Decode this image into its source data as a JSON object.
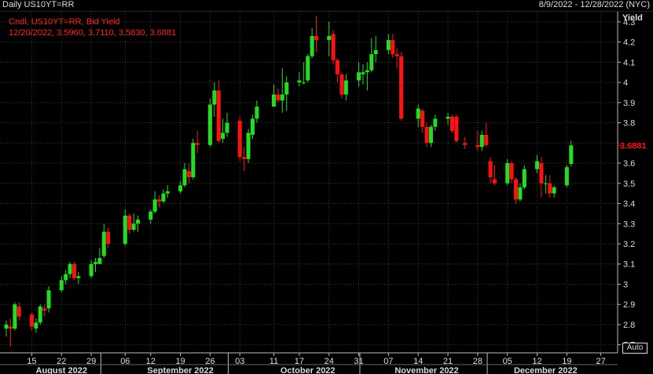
{
  "header": {
    "title": "Daily US10YT=RR",
    "date_range": "8/9/2022 - 12/28/2022 (NYC)"
  },
  "legend": {
    "line1": "Cndl, US10YT=RR, Bid Yield",
    "line2": "12/20/2022, 3.5960, 3.7110, 3.5830, 3.6881"
  },
  "auto_label": "Auto",
  "colors": {
    "up": "#22dd22",
    "down": "#ff1111",
    "grid": "#3a3a3a",
    "last_badge": "#ff1111"
  },
  "chart_data": {
    "type": "candlestick",
    "y_axis_label": "Yield",
    "ylim": [
      2.66,
      4.35
    ],
    "y_ticks": [
      2.7,
      2.8,
      2.9,
      3,
      3.1,
      3.2,
      3.3,
      3.4,
      3.5,
      3.6,
      3.7,
      3.8,
      3.9,
      4,
      4.1,
      4.2,
      4.3
    ],
    "y_tick_labels": [
      "2.7",
      "2.8",
      "2.9",
      "3",
      "3.1",
      "3.2",
      "3.3",
      "3.4",
      "3.5",
      "3.6",
      "3.7",
      "3.8",
      "3.9",
      "4",
      "4.1",
      "4.2",
      "4.3"
    ],
    "last_value": "3.6881",
    "grid": true,
    "x_day_ticks": [
      {
        "date": "2022-08-15",
        "label": "15"
      },
      {
        "date": "2022-08-22",
        "label": "22"
      },
      {
        "date": "2022-08-29",
        "label": "29"
      },
      {
        "date": "2022-09-06",
        "label": "06"
      },
      {
        "date": "2022-09-12",
        "label": "12"
      },
      {
        "date": "2022-09-19",
        "label": "19"
      },
      {
        "date": "2022-09-26",
        "label": "26"
      },
      {
        "date": "2022-10-03",
        "label": "03"
      },
      {
        "date": "2022-10-11",
        "label": "11"
      },
      {
        "date": "2022-10-17",
        "label": "17"
      },
      {
        "date": "2022-10-24",
        "label": "24"
      },
      {
        "date": "2022-10-31",
        "label": "31"
      },
      {
        "date": "2022-11-07",
        "label": "07"
      },
      {
        "date": "2022-11-14",
        "label": "14"
      },
      {
        "date": "2022-11-21",
        "label": "21"
      },
      {
        "date": "2022-11-28",
        "label": "28"
      },
      {
        "date": "2022-12-05",
        "label": "05"
      },
      {
        "date": "2022-12-12",
        "label": "12"
      },
      {
        "date": "2022-12-19",
        "label": "19"
      },
      {
        "date": "2022-12-27",
        "label": "27"
      }
    ],
    "x_months": [
      {
        "label": "August 2022",
        "date": "2022-08-22"
      },
      {
        "label": "September 2022",
        "date": "2022-09-19"
      },
      {
        "label": "October 2022",
        "date": "2022-10-19"
      },
      {
        "label": "November 2022",
        "date": "2022-11-16"
      },
      {
        "label": "December 2022",
        "date": "2022-12-14"
      }
    ],
    "x_month_boundaries": [
      "2022-09-01",
      "2022-10-01",
      "2022-11-01",
      "2022-12-01"
    ],
    "x_range": [
      "2022-08-09",
      "2022-12-28"
    ],
    "candles": [
      {
        "d": "2022-08-09",
        "o": 2.78,
        "h": 2.82,
        "l": 2.74,
        "c": 2.8
      },
      {
        "d": "2022-08-10",
        "o": 2.79,
        "h": 2.83,
        "l": 2.69,
        "c": 2.78
      },
      {
        "d": "2022-08-11",
        "o": 2.78,
        "h": 2.91,
        "l": 2.77,
        "c": 2.9
      },
      {
        "d": "2022-08-12",
        "o": 2.89,
        "h": 2.91,
        "l": 2.82,
        "c": 2.84
      },
      {
        "d": "2022-08-15",
        "o": 2.85,
        "h": 2.86,
        "l": 2.77,
        "c": 2.79
      },
      {
        "d": "2022-08-16",
        "o": 2.78,
        "h": 2.83,
        "l": 2.76,
        "c": 2.81
      },
      {
        "d": "2022-08-17",
        "o": 2.81,
        "h": 2.9,
        "l": 2.8,
        "c": 2.89
      },
      {
        "d": "2022-08-18",
        "o": 2.88,
        "h": 2.9,
        "l": 2.84,
        "c": 2.87
      },
      {
        "d": "2022-08-19",
        "o": 2.88,
        "h": 2.99,
        "l": 2.86,
        "c": 2.97
      },
      {
        "d": "2022-08-22",
        "o": 2.97,
        "h": 3.04,
        "l": 2.96,
        "c": 3.02
      },
      {
        "d": "2022-08-23",
        "o": 3.02,
        "h": 3.07,
        "l": 3.0,
        "c": 3.05
      },
      {
        "d": "2022-08-24",
        "o": 3.05,
        "h": 3.11,
        "l": 3.03,
        "c": 3.1
      },
      {
        "d": "2022-08-25",
        "o": 3.1,
        "h": 3.11,
        "l": 3.02,
        "c": 3.03
      },
      {
        "d": "2022-08-26",
        "o": 3.03,
        "h": 3.06,
        "l": 3.0,
        "c": 3.04
      },
      {
        "d": "2022-08-29",
        "o": 3.04,
        "h": 3.12,
        "l": 3.03,
        "c": 3.1
      },
      {
        "d": "2022-08-30",
        "o": 3.1,
        "h": 3.13,
        "l": 3.06,
        "c": 3.11
      },
      {
        "d": "2022-08-31",
        "o": 3.1,
        "h": 3.18,
        "l": 3.1,
        "c": 3.13
      },
      {
        "d": "2022-09-01",
        "o": 3.14,
        "h": 3.3,
        "l": 3.13,
        "c": 3.26
      },
      {
        "d": "2022-09-02",
        "o": 3.26,
        "h": 3.28,
        "l": 3.18,
        "c": 3.2
      },
      {
        "d": "2022-09-06",
        "o": 3.2,
        "h": 3.37,
        "l": 3.19,
        "c": 3.34
      },
      {
        "d": "2022-09-07",
        "o": 3.34,
        "h": 3.35,
        "l": 3.25,
        "c": 3.27
      },
      {
        "d": "2022-09-08",
        "o": 3.27,
        "h": 3.35,
        "l": 3.26,
        "c": 3.3
      },
      {
        "d": "2022-09-09",
        "o": 3.3,
        "h": 3.34,
        "l": 3.26,
        "c": 3.32
      },
      {
        "d": "2022-09-12",
        "o": 3.32,
        "h": 3.37,
        "l": 3.3,
        "c": 3.36
      },
      {
        "d": "2022-09-13",
        "o": 3.36,
        "h": 3.46,
        "l": 3.35,
        "c": 3.42
      },
      {
        "d": "2022-09-14",
        "o": 3.42,
        "h": 3.44,
        "l": 3.38,
        "c": 3.41
      },
      {
        "d": "2022-09-15",
        "o": 3.41,
        "h": 3.47,
        "l": 3.4,
        "c": 3.45
      },
      {
        "d": "2022-09-16",
        "o": 3.45,
        "h": 3.49,
        "l": 3.43,
        "c": 3.46
      },
      {
        "d": "2022-09-19",
        "o": 3.46,
        "h": 3.51,
        "l": 3.45,
        "c": 3.49
      },
      {
        "d": "2022-09-20",
        "o": 3.49,
        "h": 3.6,
        "l": 3.48,
        "c": 3.57
      },
      {
        "d": "2022-09-21",
        "o": 3.56,
        "h": 3.6,
        "l": 3.5,
        "c": 3.53
      },
      {
        "d": "2022-09-22",
        "o": 3.53,
        "h": 3.72,
        "l": 3.52,
        "c": 3.7
      },
      {
        "d": "2022-09-23",
        "o": 3.7,
        "h": 3.76,
        "l": 3.65,
        "c": 3.69
      },
      {
        "d": "2022-09-26",
        "o": 3.69,
        "h": 3.92,
        "l": 3.68,
        "c": 3.89
      },
      {
        "d": "2022-09-27",
        "o": 3.89,
        "h": 4.0,
        "l": 3.83,
        "c": 3.96
      },
      {
        "d": "2022-09-28",
        "o": 3.96,
        "h": 4.01,
        "l": 3.7,
        "c": 3.71
      },
      {
        "d": "2022-09-29",
        "o": 3.72,
        "h": 3.82,
        "l": 3.7,
        "c": 3.75
      },
      {
        "d": "2022-09-30",
        "o": 3.75,
        "h": 3.85,
        "l": 3.73,
        "c": 3.8
      },
      {
        "d": "2022-10-03",
        "o": 3.81,
        "h": 3.83,
        "l": 3.61,
        "c": 3.63
      },
      {
        "d": "2022-10-04",
        "o": 3.63,
        "h": 3.68,
        "l": 3.56,
        "c": 3.62
      },
      {
        "d": "2022-10-05",
        "o": 3.62,
        "h": 3.77,
        "l": 3.6,
        "c": 3.75
      },
      {
        "d": "2022-10-06",
        "o": 3.74,
        "h": 3.84,
        "l": 3.72,
        "c": 3.82
      },
      {
        "d": "2022-10-07",
        "o": 3.82,
        "h": 3.91,
        "l": 3.8,
        "c": 3.88
      },
      {
        "d": "2022-10-11",
        "o": 3.88,
        "h": 3.99,
        "l": 3.88,
        "c": 3.94
      },
      {
        "d": "2022-10-12",
        "o": 3.94,
        "h": 3.97,
        "l": 3.9,
        "c": 3.91
      },
      {
        "d": "2022-10-13",
        "o": 3.91,
        "h": 4.07,
        "l": 3.85,
        "c": 3.94
      },
      {
        "d": "2022-10-14",
        "o": 3.94,
        "h": 4.03,
        "l": 3.86,
        "c": 4.0
      },
      {
        "d": "2022-10-17",
        "o": 4.0,
        "h": 4.05,
        "l": 3.98,
        "c": 4.01
      },
      {
        "d": "2022-10-18",
        "o": 4.0,
        "h": 4.1,
        "l": 3.99,
        "c": 4.0
      },
      {
        "d": "2022-10-19",
        "o": 4.01,
        "h": 4.14,
        "l": 4.0,
        "c": 4.13
      },
      {
        "d": "2022-10-20",
        "o": 4.13,
        "h": 4.27,
        "l": 4.12,
        "c": 4.23
      },
      {
        "d": "2022-10-21",
        "o": 4.23,
        "h": 4.33,
        "l": 4.15,
        "c": 4.21
      },
      {
        "d": "2022-10-24",
        "o": 4.21,
        "h": 4.3,
        "l": 4.13,
        "c": 4.23
      },
      {
        "d": "2022-10-25",
        "o": 4.24,
        "h": 4.26,
        "l": 4.09,
        "c": 4.11
      },
      {
        "d": "2022-10-26",
        "o": 4.11,
        "h": 4.12,
        "l": 4.0,
        "c": 4.04
      },
      {
        "d": "2022-10-27",
        "o": 4.04,
        "h": 4.05,
        "l": 3.92,
        "c": 3.94
      },
      {
        "d": "2022-10-28",
        "o": 3.94,
        "h": 4.04,
        "l": 3.91,
        "c": 4.01
      },
      {
        "d": "2022-10-31",
        "o": 4.01,
        "h": 4.1,
        "l": 3.98,
        "c": 4.05
      },
      {
        "d": "2022-11-01",
        "o": 4.04,
        "h": 4.09,
        "l": 3.99,
        "c": 4.05
      },
      {
        "d": "2022-11-02",
        "o": 4.05,
        "h": 4.1,
        "l": 3.96,
        "c": 4.06
      },
      {
        "d": "2022-11-03",
        "o": 4.06,
        "h": 4.22,
        "l": 4.05,
        "c": 4.14
      },
      {
        "d": "2022-11-04",
        "o": 4.14,
        "h": 4.23,
        "l": 4.1,
        "c": 4.16
      },
      {
        "d": "2022-11-07",
        "o": 4.16,
        "h": 4.24,
        "l": 4.14,
        "c": 4.21
      },
      {
        "d": "2022-11-08",
        "o": 4.21,
        "h": 4.24,
        "l": 4.12,
        "c": 4.14
      },
      {
        "d": "2022-11-09",
        "o": 4.14,
        "h": 4.17,
        "l": 4.07,
        "c": 4.13
      },
      {
        "d": "2022-11-10",
        "o": 4.13,
        "h": 4.15,
        "l": 3.81,
        "c": 3.82
      },
      {
        "d": "2022-11-14",
        "o": 3.82,
        "h": 3.89,
        "l": 3.78,
        "c": 3.87
      },
      {
        "d": "2022-11-15",
        "o": 3.86,
        "h": 3.87,
        "l": 3.75,
        "c": 3.78
      },
      {
        "d": "2022-11-16",
        "o": 3.78,
        "h": 3.8,
        "l": 3.68,
        "c": 3.7
      },
      {
        "d": "2022-11-17",
        "o": 3.7,
        "h": 3.79,
        "l": 3.68,
        "c": 3.78
      },
      {
        "d": "2022-11-18",
        "o": 3.78,
        "h": 3.84,
        "l": 3.76,
        "c": 3.82
      },
      {
        "d": "2022-11-21",
        "o": 3.82,
        "h": 3.85,
        "l": 3.79,
        "c": 3.83
      },
      {
        "d": "2022-11-22",
        "o": 3.83,
        "h": 3.84,
        "l": 3.75,
        "c": 3.76
      },
      {
        "d": "2022-11-23",
        "o": 3.83,
        "h": 3.84,
        "l": 3.7,
        "c": 3.71
      },
      {
        "d": "2022-11-25",
        "o": 3.7,
        "h": 3.73,
        "l": 3.67,
        "c": 3.69
      },
      {
        "d": "2022-11-28",
        "o": 3.69,
        "h": 3.76,
        "l": 3.66,
        "c": 3.68
      },
      {
        "d": "2022-11-29",
        "o": 3.68,
        "h": 3.76,
        "l": 3.66,
        "c": 3.74
      },
      {
        "d": "2022-11-30",
        "o": 3.74,
        "h": 3.8,
        "l": 3.68,
        "c": 3.69
      },
      {
        "d": "2022-12-01",
        "o": 3.61,
        "h": 3.63,
        "l": 3.5,
        "c": 3.53
      },
      {
        "d": "2022-12-02",
        "o": 3.52,
        "h": 3.59,
        "l": 3.49,
        "c": 3.5
      },
      {
        "d": "2022-12-05",
        "o": 3.5,
        "h": 3.62,
        "l": 3.49,
        "c": 3.6
      },
      {
        "d": "2022-12-06",
        "o": 3.6,
        "h": 3.61,
        "l": 3.5,
        "c": 3.52
      },
      {
        "d": "2022-12-07",
        "o": 3.52,
        "h": 3.53,
        "l": 3.4,
        "c": 3.42
      },
      {
        "d": "2022-12-08",
        "o": 3.42,
        "h": 3.5,
        "l": 3.41,
        "c": 3.48
      },
      {
        "d": "2022-12-09",
        "o": 3.48,
        "h": 3.59,
        "l": 3.47,
        "c": 3.57
      },
      {
        "d": "2022-12-12",
        "o": 3.57,
        "h": 3.64,
        "l": 3.55,
        "c": 3.61
      },
      {
        "d": "2022-12-13",
        "o": 3.6,
        "h": 3.63,
        "l": 3.43,
        "c": 3.5
      },
      {
        "d": "2022-12-14",
        "o": 3.5,
        "h": 3.54,
        "l": 3.45,
        "c": 3.5
      },
      {
        "d": "2022-12-15",
        "o": 3.5,
        "h": 3.54,
        "l": 3.43,
        "c": 3.45
      },
      {
        "d": "2022-12-16",
        "o": 3.45,
        "h": 3.49,
        "l": 3.43,
        "c": 3.48
      },
      {
        "d": "2022-12-19",
        "o": 3.49,
        "h": 3.59,
        "l": 3.48,
        "c": 3.58
      },
      {
        "d": "2022-12-20",
        "o": 3.596,
        "h": 3.711,
        "l": 3.583,
        "c": 3.6881
      }
    ]
  }
}
